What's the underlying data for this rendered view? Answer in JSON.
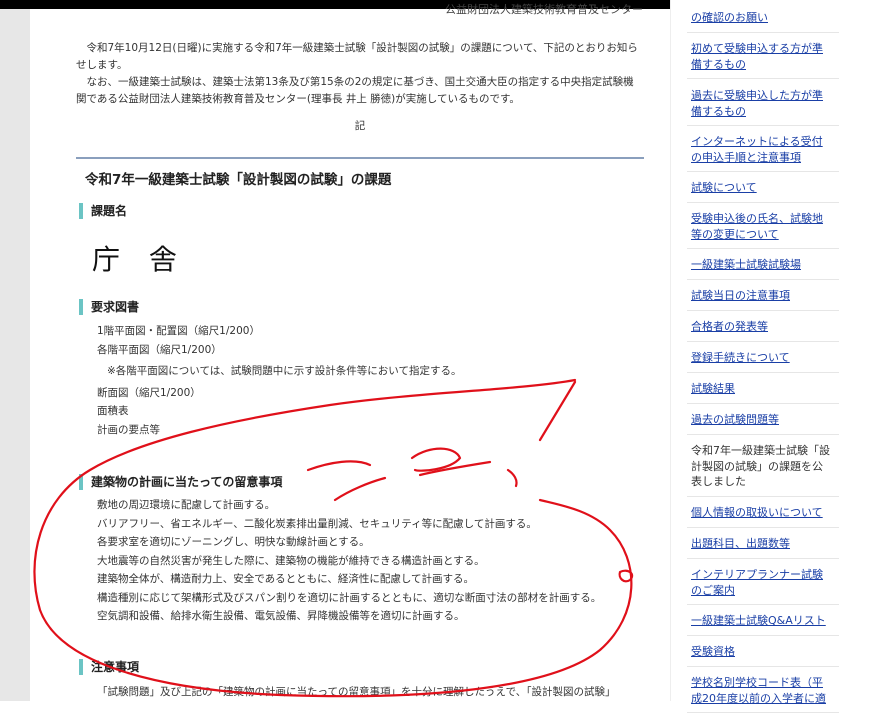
{
  "header": {
    "org": "公益財団法人建築技術教育普及センター"
  },
  "intro": {
    "para1": "令和7年10月12日(日曜)に実施する令和7年一級建築士試験「設計製図の試験」の課題について、下記のとおりお知らせします。",
    "para2": "なお、一級建築士試験は、建築士法第13条及び第15条の2の規定に基づき、国土交通大臣の指定する中央指定試験機関である公益財団法人建築技術教育普及センター(理事長 井上 勝徳)が実施しているものです。",
    "ki": "記"
  },
  "section_title": "令和7年一級建築士試験「設計製図の試験」の課題",
  "kadai": {
    "heading": "課題名",
    "name": "庁 舎"
  },
  "youkyu": {
    "heading": "要求図書",
    "items": [
      "1階平面図・配置図（縮尺1/200）",
      "各階平面図（縮尺1/200）"
    ],
    "note": "※各階平面図については、試験問題中に示す設計条件等において指定する。",
    "items2": [
      "断面図（縮尺1/200）",
      "面積表",
      "計画の要点等"
    ]
  },
  "ryuui": {
    "heading": "建築物の計画に当たっての留意事項",
    "items": [
      "敷地の周辺環境に配慮して計画する。",
      "バリアフリー、省エネルギー、二酸化炭素排出量削減、セキュリティ等に配慮して計画する。",
      "各要求室を適切にゾーニングし、明快な動線計画とする。",
      "大地震等の自然災害が発生した際に、建築物の機能が維持できる構造計画とする。",
      "建築物全体が、構造耐力上、安全であるとともに、経済性に配慮して計画する。",
      "構造種別に応じて架構形式及びスパン割りを適切に計画するとともに、適切な断面寸法の部材を計画する。",
      "空気調和設備、給排水衛生設備、電気設備、昇降機設備等を適切に計画する。"
    ]
  },
  "chuui": {
    "heading": "注意事項",
    "text": "「試験問題」及び上記の「建築物の計画に当たっての留意事項」を十分に理解したうえで、「設計製図の試験」"
  },
  "sidebar": {
    "items": [
      {
        "label": "の確認のお願い",
        "link": true
      },
      {
        "label": "初めて受験申込する方が準備するもの",
        "link": true
      },
      {
        "label": "過去に受験申込した方が準備するもの",
        "link": true
      },
      {
        "label": "インターネットによる受付の申込手順と注意事項",
        "link": true
      },
      {
        "label": "試験について",
        "link": true
      },
      {
        "label": "受験申込後の氏名、試験地等の変更について",
        "link": true
      },
      {
        "label": "一級建築士試験試験場",
        "link": true
      },
      {
        "label": "試験当日の注意事項",
        "link": true
      },
      {
        "label": "合格者の発表等",
        "link": true
      },
      {
        "label": "登録手続きについて",
        "link": true
      },
      {
        "label": "試験結果",
        "link": true
      },
      {
        "label": "過去の試験問題等",
        "link": true
      },
      {
        "label": "令和7年一級建築士試験「設計製図の試験」の課題を公表しました",
        "link": false
      },
      {
        "label": "個人情報の取扱いについて",
        "link": true
      },
      {
        "label": "出題科目、出題数等",
        "link": true
      },
      {
        "label": "インテリアプランナー試験のご案内",
        "link": true
      },
      {
        "label": "一級建築士試験Q&Aリスト",
        "link": true
      },
      {
        "label": "受験資格",
        "link": true
      },
      {
        "label": "学校名別学校コード表（平成20年度以前の入学者に適",
        "link": true
      }
    ]
  },
  "annotation_color": "#e0101a"
}
